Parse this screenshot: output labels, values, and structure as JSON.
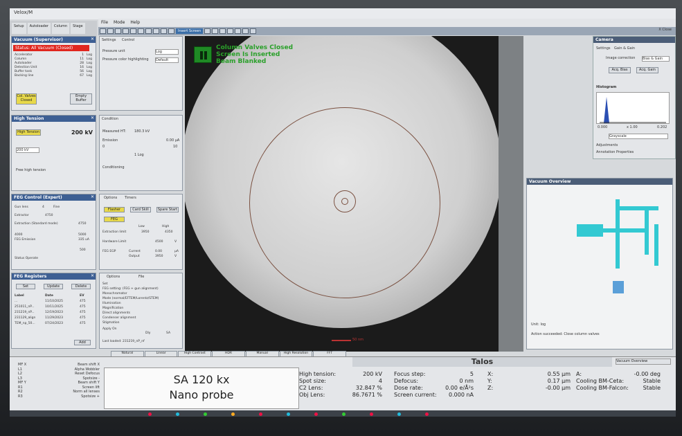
{
  "app": {
    "title": "Velox/M",
    "menu": [
      "File",
      "Mode",
      "Help"
    ],
    "close": "X Close"
  },
  "tabs": [
    "Setup",
    "Autoloader",
    "Column",
    "Stage"
  ],
  "toolbar": {
    "insert_label": "Insert Screen"
  },
  "vacuum": {
    "title": "Vacuum (Supervisor)",
    "alert": "Status: All Vacuum (Closed)",
    "rows": [
      {
        "name": "Accelerator",
        "val": "1",
        "unit": "Log"
      },
      {
        "name": "Column",
        "val": "11",
        "unit": "Log"
      },
      {
        "name": "Autoloader",
        "val": "28",
        "unit": "Log"
      },
      {
        "name": "Detection Unit",
        "val": "16",
        "unit": "Log"
      },
      {
        "name": "Buffer tank",
        "val": "56",
        "unit": "Log"
      },
      {
        "name": "Backing line",
        "val": "67",
        "unit": "Log"
      }
    ],
    "btn_col": "Col. Valves Closed",
    "btn_buffer": "Empty Buffer"
  },
  "settings": {
    "tab1": "Settings",
    "tab2": "Control",
    "row1": "Pressure unit",
    "row1v": "Log",
    "row2": "Pressure color highlighting",
    "row2v": "Default"
  },
  "ht": {
    "title": "High Tension",
    "btn": "High Tension",
    "kv": "200 kV",
    "sel": "200 kV",
    "free": "Free high tension"
  },
  "cond": {
    "tab": "Condition",
    "meas": "Measured HT:",
    "measv": "180.3 kV",
    "emission": "Emission",
    "emv": "0.00 µA",
    "s1": "0",
    "s2": "10",
    "s3": "1 Log",
    "cond": "Conditioning"
  },
  "feg": {
    "title": "FEG Control (Expert)",
    "gun": "Gun lens",
    "gunv": "4",
    "fine": "Fine",
    "extr": "Extractor",
    "extrv": "4750",
    "ext_mode": "Extraction (Standard mode)",
    "ext_val": "4750",
    "emission": "FEG Emission",
    "emv": "335 uA",
    "op": "Status Operate",
    "scale1": "4000",
    "scale2": "5000",
    "scale3": "500"
  },
  "options": {
    "tab1": "Options",
    "tab2": "Timers",
    "b1": "Flasher",
    "b2": "Card Skill",
    "b3": "Spare Start",
    "b4": "FEG",
    "ext_lim": "Extraction limit",
    "low": "Low",
    "high": "High",
    "lowv": "3950",
    "highv": "4350",
    "hw_lim": "Hardware Limit",
    "hwv": "4500",
    "feg_egp": "FEG EGP",
    "cur": "Current",
    "curv": "0.00",
    "out": "Output",
    "outv": "3950",
    "unitA": "µA",
    "unitV": "V"
  },
  "regs": {
    "title": "FEG Registers",
    "set": "Set",
    "update": "Update",
    "delete": "Delete",
    "h1": "Label",
    "h2": "Date",
    "h3": "EV",
    "rows": [
      {
        "l": "...",
        "d": "11/10/2025",
        "e": "475"
      },
      {
        "l": "251011_nP...",
        "d": "10/11/2025",
        "e": "475"
      },
      {
        "l": "231219_nP...",
        "d": "12/19/2023",
        "e": "475"
      },
      {
        "l": "231129_align",
        "d": "11/29/2023",
        "e": "475"
      },
      {
        "l": "TEM_np_50...",
        "d": "07/24/2023",
        "e": "475"
      }
    ],
    "add": "Add"
  },
  "regopt": {
    "tab1": "Options",
    "tab2": "File",
    "set": "Set",
    "items": [
      "FEG setting: (FEG + gun alignment)",
      "Monochromator",
      "Mode (normal/EFTEM/Lorentz/STEM)",
      "Illumination",
      "Magnification",
      "Direct alignments",
      "Condenser alignment",
      "Stigmation"
    ],
    "apply": "Apply On",
    "last": "Last loaded: 231219_nP_nf",
    "c1": "Dly",
    "c2": "SA"
  },
  "viewer": {
    "status1": "Column Valves Closed",
    "status2": "Screen Is Inserted",
    "status3": "Beam Blanked",
    "scale": "50 nm"
  },
  "camera": {
    "title": "Camera",
    "tab1": "Settings",
    "tab2": "Gain & Gain",
    "img_corr": "Image correction",
    "img_corr_v": "Bias & Gain",
    "b1": "Acq. Bias",
    "b2": "Acq. Gain",
    "hist": "Histogram",
    "h0": "0.000",
    "h1": "x 1.00",
    "h2": "0.202",
    "lut": "Grayscale",
    "adj": "Adjustments",
    "ann": "Annotation Properties"
  },
  "vacov": {
    "title": "Vacuum Overview",
    "unit": "Unit: log",
    "action": "Action succeeded: Close column valves"
  },
  "filters": [
    "Natural",
    "Linear",
    "High Contrast",
    "HDR",
    "Manual",
    "High Resolution",
    "FFT"
  ],
  "mf": [
    {
      "k": "MF X",
      "v": "Beam shift X"
    },
    {
      "k": "L1",
      "v": "Alpha Wobbler"
    },
    {
      "k": "L2",
      "v": "Reset Defocus"
    },
    {
      "k": "L3",
      "v": "Spotsize -"
    },
    {
      "k": "MF Y",
      "v": "Beam shift Y"
    },
    {
      "k": "R1",
      "v": "Screen lift"
    },
    {
      "k": "R2",
      "v": "Norm all lenses"
    },
    {
      "k": "R3",
      "v": "Spotsize +"
    }
  ],
  "mode": {
    "mag": "SA 120 kx",
    "probe": "Nano probe"
  },
  "talos": "Talos",
  "vov_btn": "Vacuum Overview",
  "params": {
    "col1": [
      {
        "k": "High tension:",
        "v": "200 kV"
      },
      {
        "k": "Spot size:",
        "v": "4"
      },
      {
        "k": "C2 Lens:",
        "v": "32.847 %"
      },
      {
        "k": "Obj Lens:",
        "v": "86.7671 %"
      }
    ],
    "col2": [
      {
        "k": "Focus step:",
        "v": "5"
      },
      {
        "k": "Defocus:",
        "v": "0 nm"
      },
      {
        "k": "Dose rate:",
        "v": "0.00 e/Å²s"
      },
      {
        "k": "Screen current:",
        "v": "0.000 nA"
      }
    ],
    "col3": [
      {
        "k": "X:",
        "v": "0.55 µm"
      },
      {
        "k": "Y:",
        "v": "0.17 µm"
      },
      {
        "k": "Z:",
        "v": "-0.00 µm"
      }
    ],
    "col4": [
      {
        "k": "A:",
        "v": "-0.00 deg"
      },
      {
        "k": "Cooling BM-Ceta:",
        "v": "Stable"
      },
      {
        "k": "Cooling BM-Falcon:",
        "v": "Stable"
      }
    ]
  }
}
